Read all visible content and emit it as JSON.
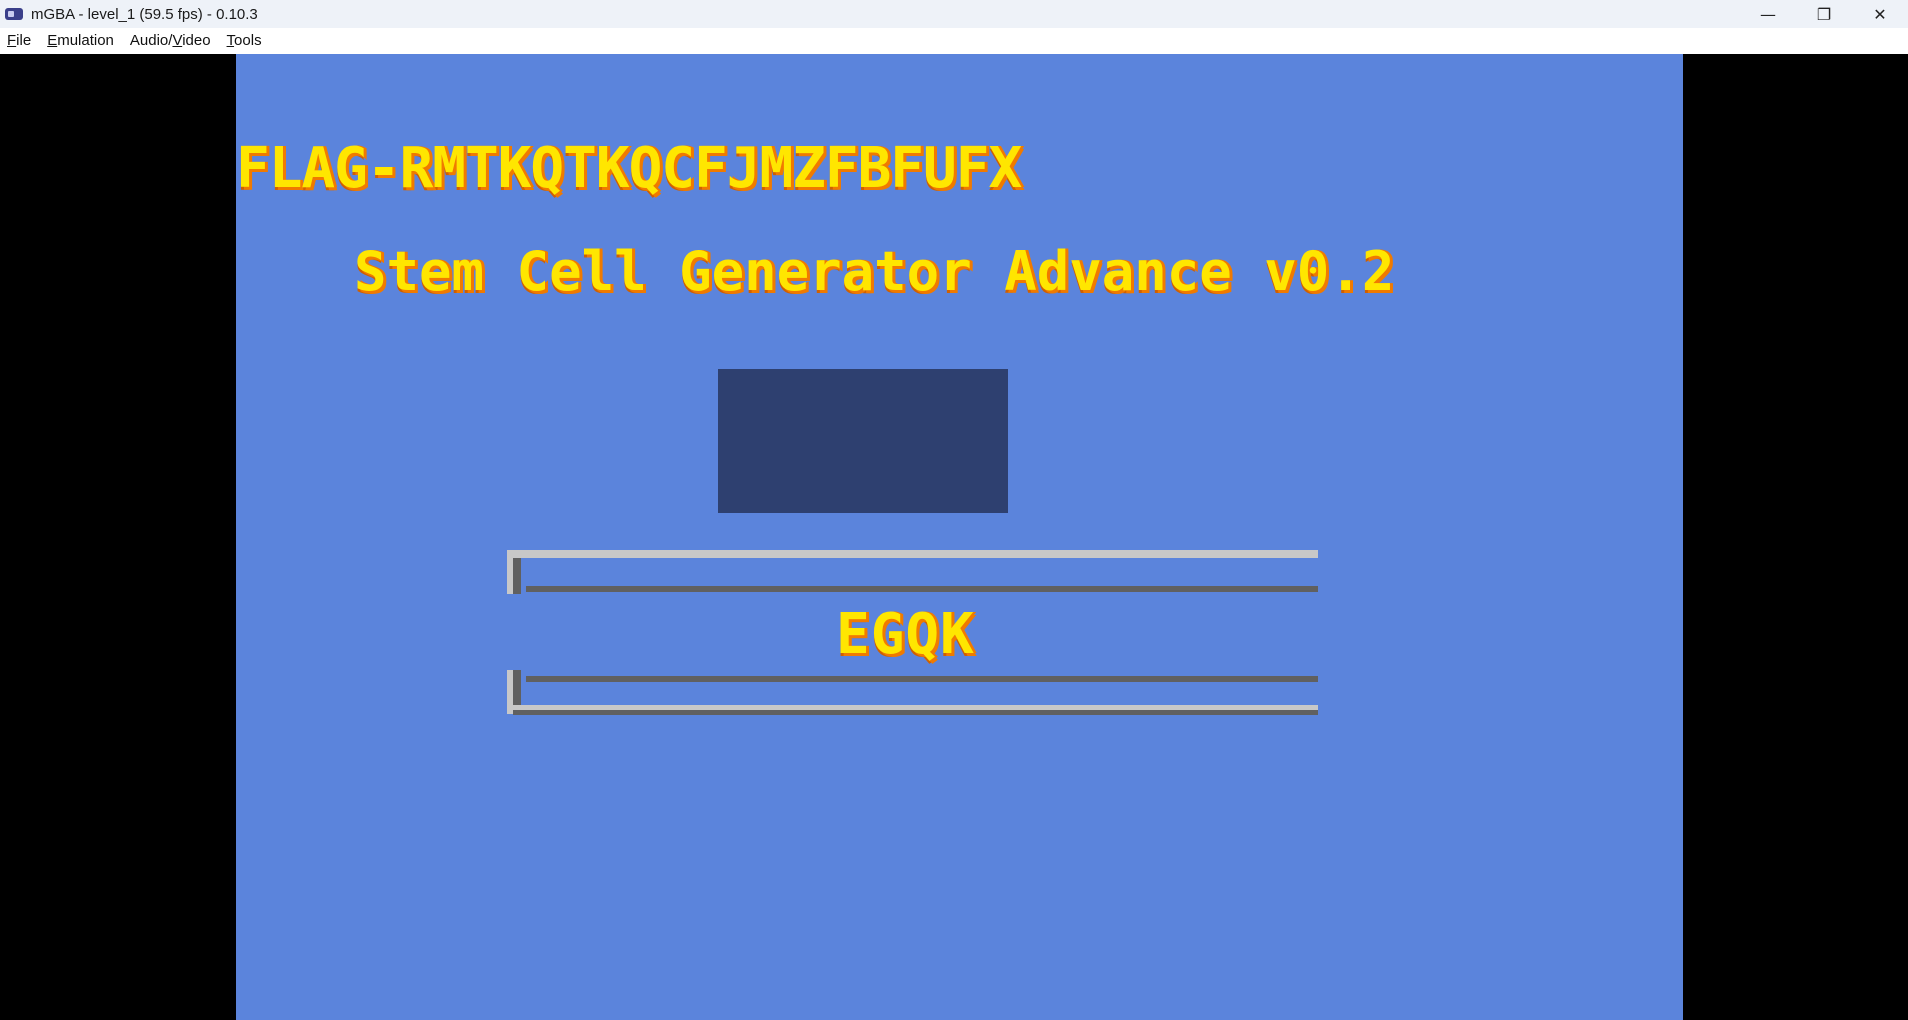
{
  "window": {
    "title": "mGBA - level_1 (59.5 fps) - 0.10.3",
    "controls": {
      "minimize": "—",
      "restore": "❐",
      "close": "✕"
    }
  },
  "menu": {
    "items": [
      {
        "mnemonic": "F",
        "rest": "ile"
      },
      {
        "mnemonic": "E",
        "rest": "mulation"
      },
      {
        "pre": "Audio/",
        "mnemonic": "V",
        "rest": "ideo"
      },
      {
        "mnemonic": "T",
        "rest": "ools"
      }
    ]
  },
  "game": {
    "flag": "FLAG-RMTKQTKQCFJMZFBFUFX",
    "title": "Stem Cell Generator Advance v0.2",
    "code": "EGQK"
  },
  "colors": {
    "screen_bg": "#5b84dc",
    "text_fill": "#ffe600",
    "text_shadow": "#f07a00",
    "dark_box": "#2e4070",
    "frame_light": "#c8c8c8",
    "frame_dark": "#606060"
  }
}
